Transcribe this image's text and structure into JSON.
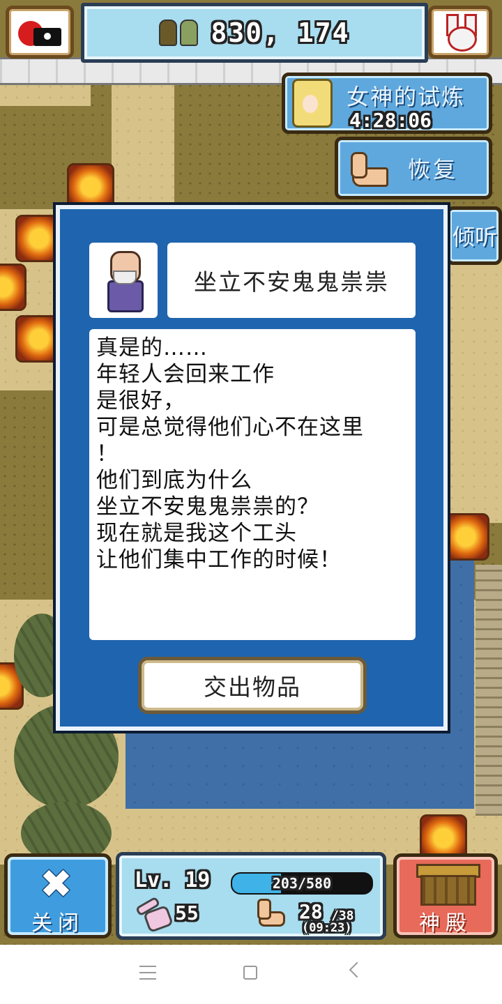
{
  "hud": {
    "population": "830, 174",
    "camera_icon": "camera-record-icon",
    "bunny_icon": "bunny-mascot-icon"
  },
  "side_buttons": {
    "trial_label": "女神的试炼",
    "trial_timer": "4:28:06",
    "recover_label": "恢复",
    "listen_label": "倾听"
  },
  "dialog": {
    "speaker_name": "坐立不安鬼鬼祟祟",
    "message_lines": [
      "真是的……",
      "年轻人会回来工作",
      "是很好，",
      "可是总觉得他们心不在这里",
      "！",
      "他们到底为什么",
      "坐立不安鬼鬼祟祟的？",
      "现在就是我这个工头",
      "让他们集中工作的时候！"
    ],
    "action_button": "交出物品"
  },
  "bottom_bar": {
    "close_label": "关闭",
    "level": "Lv. 19",
    "exp_text": "203/580",
    "exp_fraction": 0.35,
    "power": "55",
    "stamina": "28",
    "stamina_max": "/38",
    "stamina_timer": "(09:23)",
    "temple_label": "神殿"
  },
  "colors": {
    "dialog_blue": "#1f64ae",
    "button_blue": "#3f9ddf",
    "temple_red": "#e86a5a",
    "panel_cyan": "#a8dcef"
  }
}
